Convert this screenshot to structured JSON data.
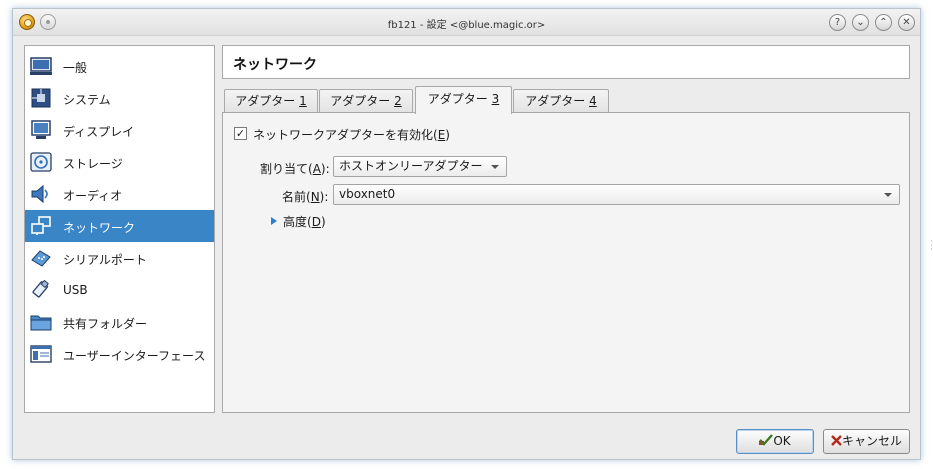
{
  "window": {
    "title": "fb121 - 設定 <@blue.magic.or>",
    "buttons": [
      "?",
      "⌄",
      "⌃",
      "✕"
    ]
  },
  "sidebar": {
    "active_index": 5,
    "items": [
      {
        "label": "一般",
        "icon": "general-monitor-icon"
      },
      {
        "label": "システム",
        "icon": "system-chip-icon"
      },
      {
        "label": "ディスプレイ",
        "icon": "display-monitor-icon"
      },
      {
        "label": "ストレージ",
        "icon": "storage-disk-icon"
      },
      {
        "label": "オーディオ",
        "icon": "audio-speaker-icon"
      },
      {
        "label": "ネットワーク",
        "icon": "network-icon"
      },
      {
        "label": "シリアルポート",
        "icon": "serial-port-icon"
      },
      {
        "label": "USB",
        "icon": "usb-icon"
      },
      {
        "label": "共有フォルダー",
        "icon": "shared-folder-icon"
      },
      {
        "label": "ユーザーインターフェース",
        "icon": "user-interface-icon"
      }
    ]
  },
  "content": {
    "heading": "ネットワーク",
    "tabs": [
      {
        "prefix": "アダプター ",
        "num": "1"
      },
      {
        "prefix": "アダプター ",
        "num": "2"
      },
      {
        "prefix": "アダプター ",
        "num": "3"
      },
      {
        "prefix": "アダプター ",
        "num": "4"
      }
    ],
    "active_tab": 2,
    "enable_adapter": {
      "label_prefix": "ネットワークアダプターを有効化(",
      "key": "E",
      "label_suffix": ")",
      "checked": true,
      "mark": "✓"
    },
    "attached_to": {
      "label_prefix": "割り当て(",
      "key": "A",
      "label_suffix": "):",
      "value": "ホストオンリーアダプター"
    },
    "name": {
      "label_prefix": "名前(",
      "key": "N",
      "label_suffix": "):",
      "value": "vboxnet0"
    },
    "advanced": {
      "label_prefix": "高度(",
      "key": "D",
      "label_suffix": ")"
    }
  },
  "footer": {
    "ok_label": "OK",
    "cancel_label": "キャンセル"
  }
}
